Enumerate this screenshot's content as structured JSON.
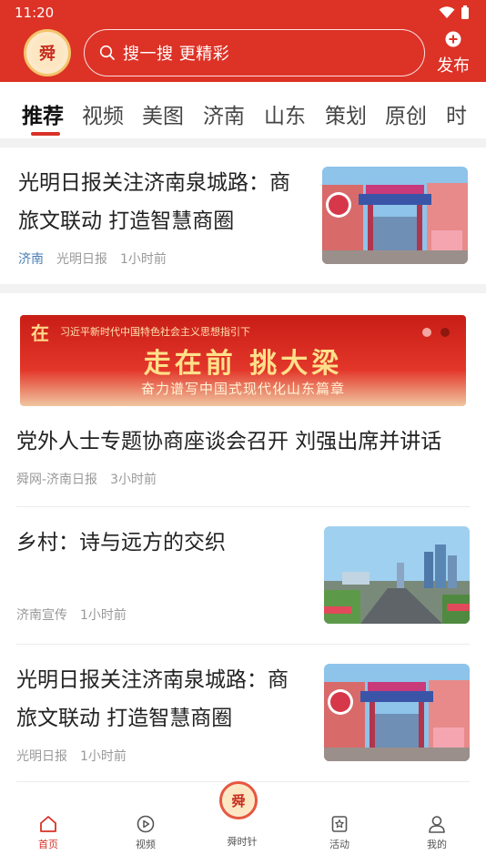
{
  "status_bar": {
    "time": "11:20"
  },
  "header": {
    "logo_text": "舜网",
    "search_placeholder": "搜一搜 更精彩",
    "publish_label": "发布"
  },
  "tabs": [
    "推荐",
    "视频",
    "美图",
    "济南",
    "山东",
    "策划",
    "原创",
    "时"
  ],
  "active_tab": "推荐",
  "articles": [
    {
      "title_line1": "光明日报关注济南泉城路：商",
      "title_line2": "旅文联动 打造智慧商圈",
      "channel": "济南",
      "source": "光明日报",
      "time": "1小时前",
      "thumb": "street-gate-image"
    }
  ],
  "banner": {
    "lead_char": "在",
    "small_text": "习近平新时代中国特色社会主义思想指引下",
    "headline": "走在前 挑大梁",
    "subheadline": "奋力谱写中国式现代化山东篇章"
  },
  "feed": [
    {
      "title": "党外人士专题协商座谈会召开 刘强出席并讲话",
      "source": "舜网-济南日报",
      "time": "3小时前"
    },
    {
      "title": "乡村：诗与远方的交织",
      "source": "济南宣传",
      "time": "1小时前",
      "thumb": "city-skyline-image"
    },
    {
      "title_line1": "光明日报关注济南泉城路：商",
      "title_line2": "旅文联动 打造智慧商圈",
      "source": "光明日报",
      "time": "1小时前",
      "thumb": "street-gate-image"
    }
  ],
  "bottom_nav": [
    {
      "label": "首页",
      "icon": "home-icon",
      "active": true
    },
    {
      "label": "视频",
      "icon": "play-icon",
      "active": false
    },
    {
      "label": "舜时针",
      "icon": "shunshizhen-logo",
      "active": false
    },
    {
      "label": "活动",
      "icon": "star-icon",
      "active": false
    },
    {
      "label": "我的",
      "icon": "person-icon",
      "active": false
    }
  ],
  "colors": {
    "brand_red": "#dd3226",
    "tab_underline": "#d93127",
    "channel_blue": "#4a7fb5"
  }
}
